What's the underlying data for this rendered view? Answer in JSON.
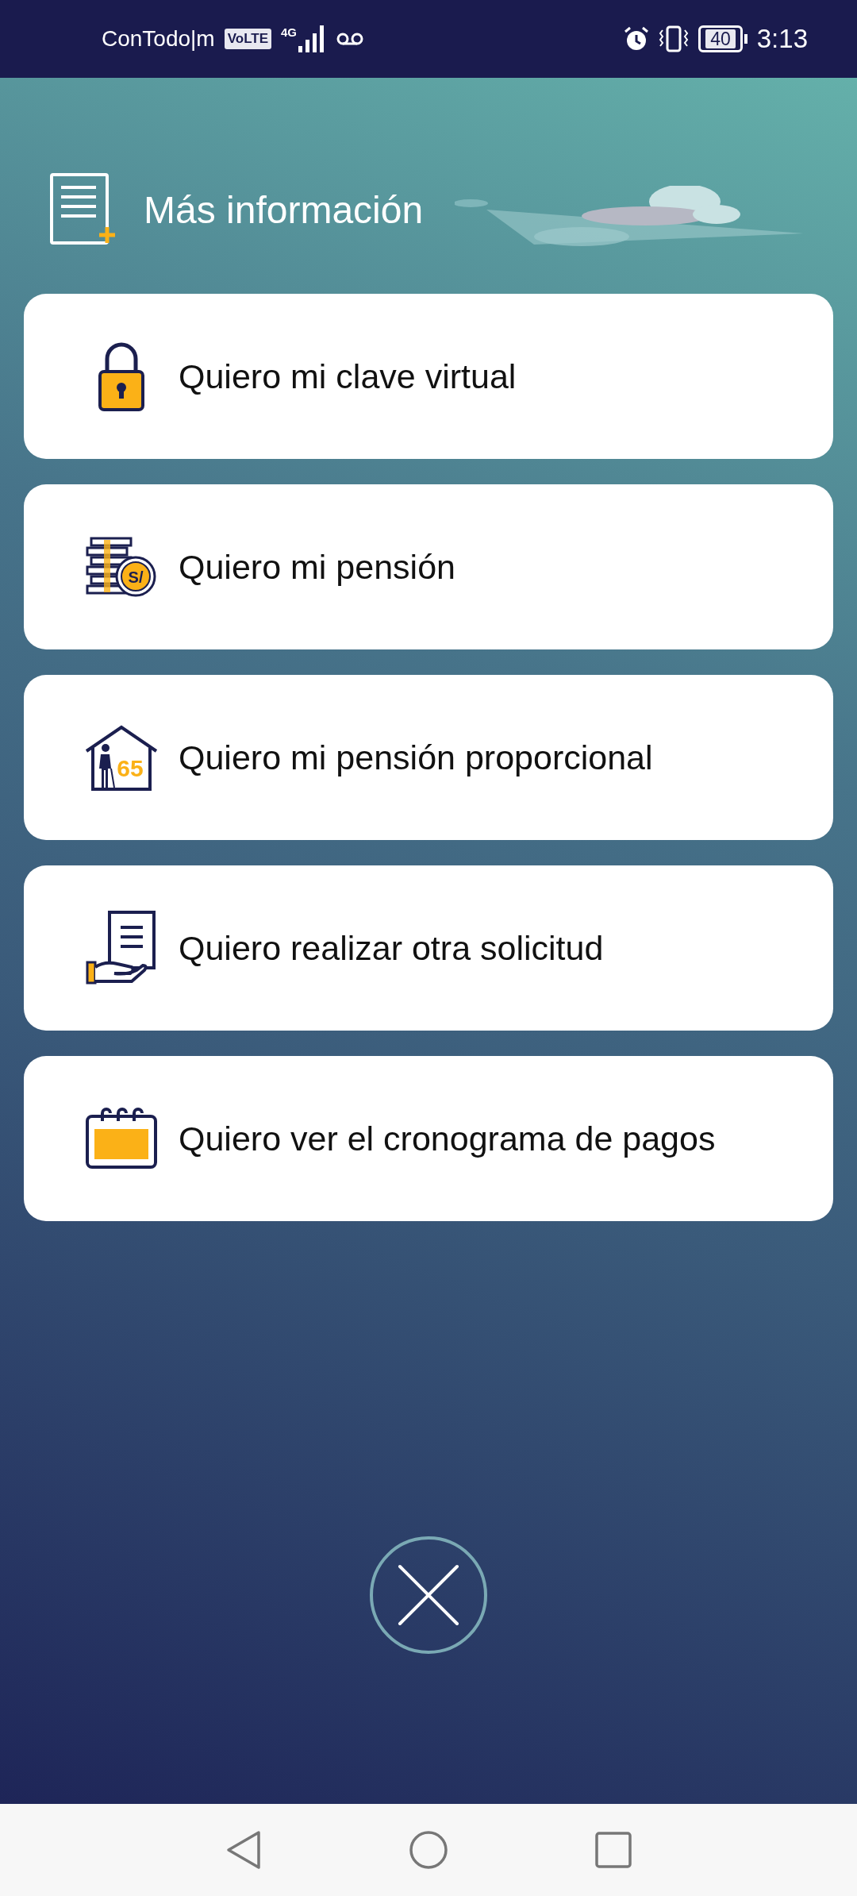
{
  "status_bar": {
    "carrier": "ConTodo|m",
    "volte": "VoLTE",
    "network": "4G",
    "battery": "40",
    "time": "3:13"
  },
  "header": {
    "title": "Más información"
  },
  "options": [
    {
      "kind": "lock",
      "label": "Quiero mi clave virtual"
    },
    {
      "kind": "coins",
      "label": "Quiero mi pensión",
      "icon_text": "S/"
    },
    {
      "kind": "house",
      "label": "Quiero mi pensión proporcional",
      "icon_text": "65"
    },
    {
      "kind": "document",
      "label": "Quiero realizar otra solicitud"
    },
    {
      "kind": "calendar",
      "label": "Quiero ver el cronograma de pagos"
    }
  ]
}
